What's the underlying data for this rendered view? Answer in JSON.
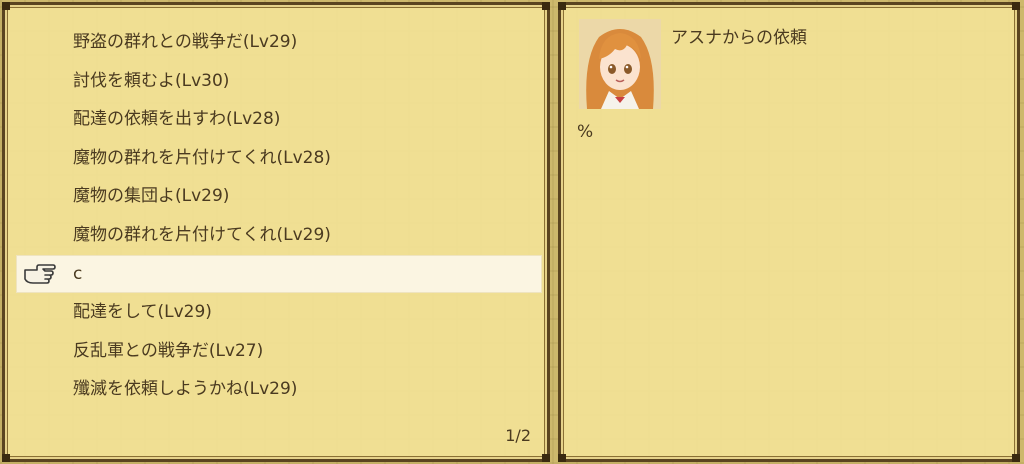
{
  "quest_list": {
    "items": [
      {
        "label": "野盗の群れとの戦争だ(Lv29)"
      },
      {
        "label": "討伐を頼むよ(Lv30)"
      },
      {
        "label": "配達の依頼を出すわ(Lv28)"
      },
      {
        "label": "魔物の群れを片付けてくれ(Lv28)"
      },
      {
        "label": "魔物の集団よ(Lv29)"
      },
      {
        "label": "魔物の群れを片付けてくれ(Lv29)"
      },
      {
        "label": "c",
        "selected": true
      },
      {
        "label": "配達をして(Lv29)"
      },
      {
        "label": "反乱軍との戦争だ(Lv27)"
      },
      {
        "label": "殲滅を依頼しようかね(Lv29)"
      }
    ],
    "page_indicator": "1/2",
    "cursor_icon": "pointing-hand-icon"
  },
  "detail": {
    "requester_title": "アスナからの依頼",
    "body_text": "%",
    "portrait_icon": "character-portrait"
  },
  "colors": {
    "panel_bg": "#f2e296",
    "border": "#5a4420",
    "text": "#4a3a20",
    "selection": "#fbf5e2"
  }
}
